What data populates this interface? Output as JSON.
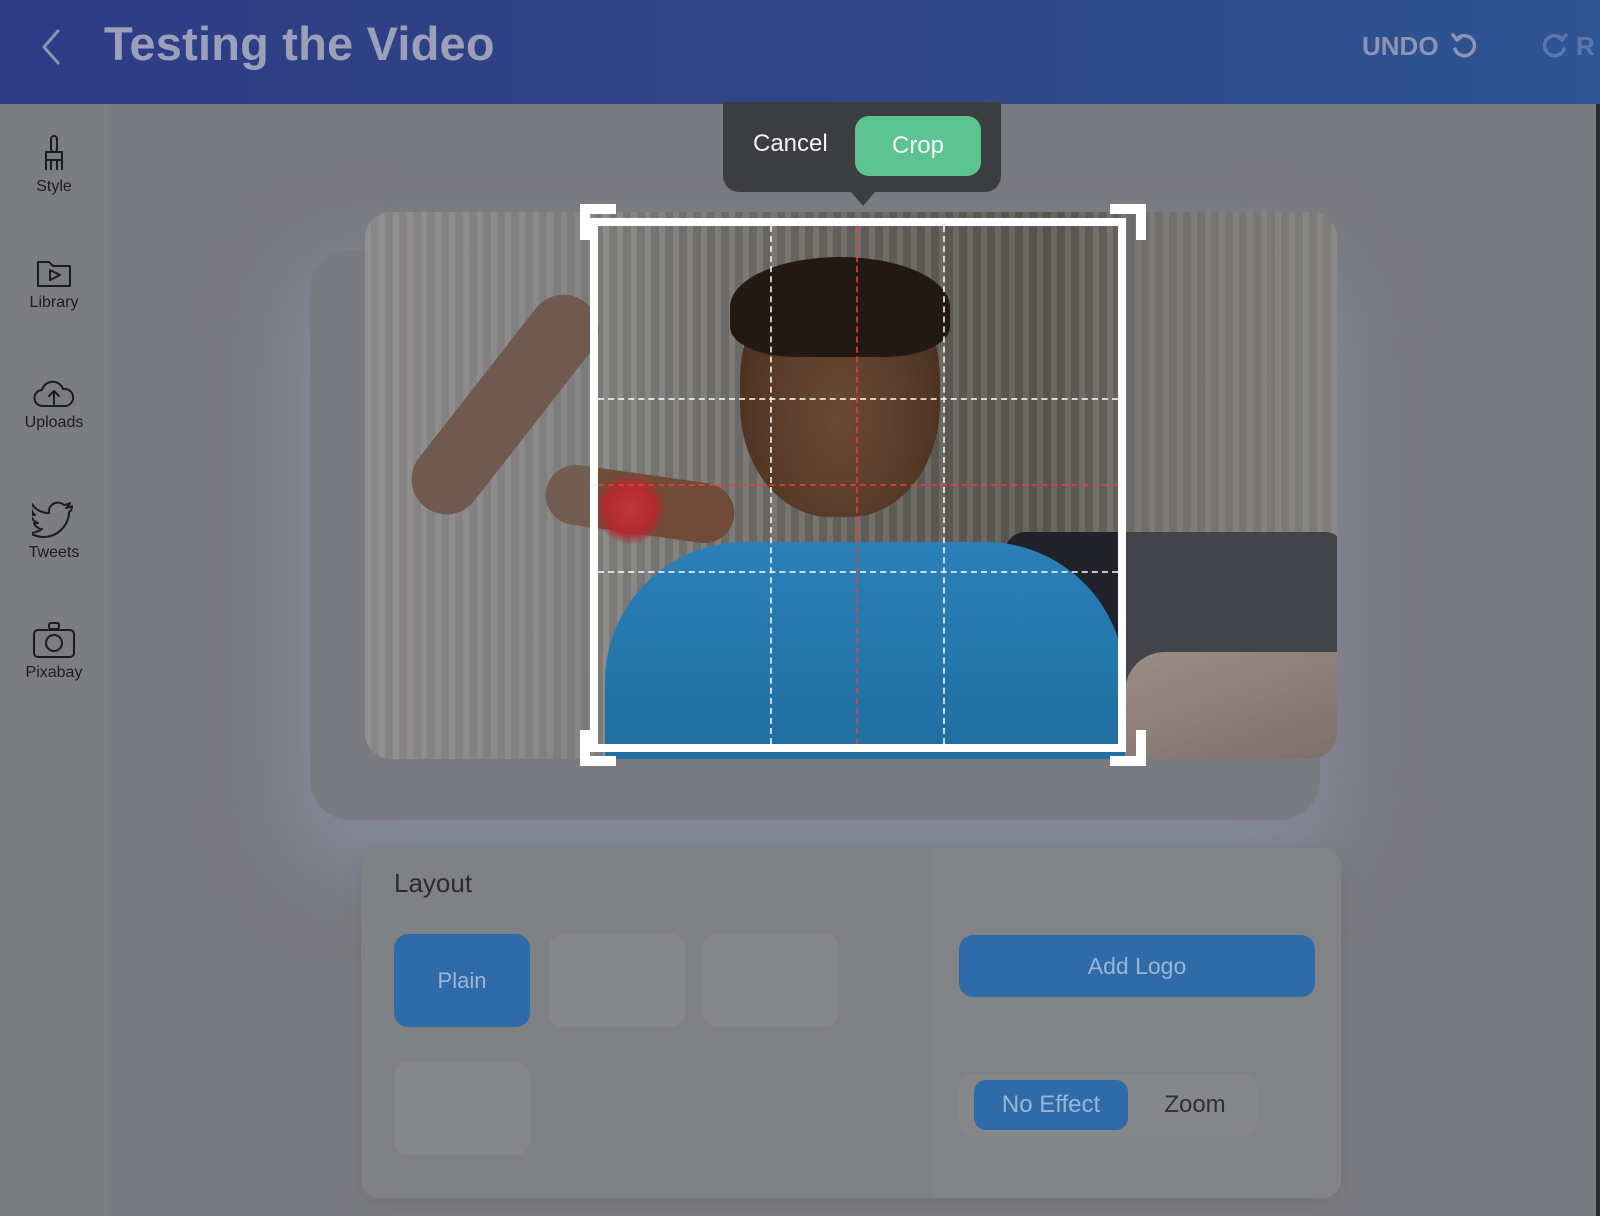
{
  "header": {
    "title": "Testing the Video",
    "undo_label": "UNDO",
    "redo_label": "R"
  },
  "sidebar": {
    "items": [
      {
        "label": "Style",
        "icon": "brush-icon"
      },
      {
        "label": "Library",
        "icon": "folder-play-icon"
      },
      {
        "label": "Uploads",
        "icon": "cloud-upload-icon"
      },
      {
        "label": "Tweets",
        "icon": "twitter-bird-icon"
      },
      {
        "label": "Pixabay",
        "icon": "camera-icon"
      }
    ]
  },
  "crop_popup": {
    "cancel_label": "Cancel",
    "crop_label": "Crop"
  },
  "layout": {
    "title": "Layout",
    "options": [
      "Plain"
    ],
    "add_logo_label": "Add Logo",
    "effects": {
      "selected": "No Effect",
      "options": [
        "No Effect",
        "Zoom"
      ]
    }
  },
  "colors": {
    "header_bg": "#2f4585",
    "accent_blue": "#2f6aa9",
    "crop_green": "#5dc391",
    "popup_bg": "#3c3d41"
  }
}
